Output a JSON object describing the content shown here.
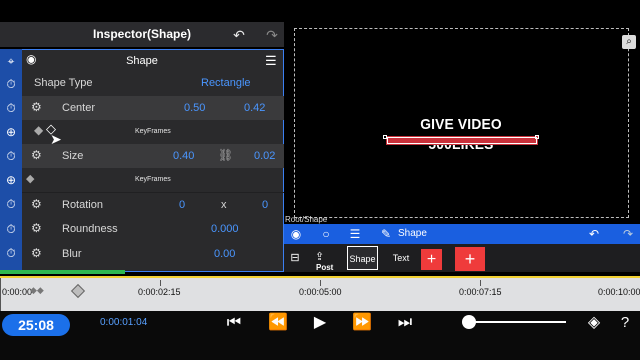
{
  "inspector": {
    "title": "Inspector(Shape)",
    "header_label": "Shape",
    "shape_type_label": "Shape Type",
    "shape_type_value": "Rectangle",
    "center": {
      "label": "Center",
      "x": "0.50",
      "y": "0.42"
    },
    "keyframes_label": "KeyFrames",
    "size": {
      "label": "Size",
      "x": "0.40",
      "y": "0.02"
    },
    "rotation": {
      "label": "Rotation",
      "value": "0",
      "sep": "x",
      "value2": "0"
    },
    "roundness": {
      "label": "Roundness",
      "value": "0.000"
    },
    "blur": {
      "label": "Blur",
      "value": "0.00"
    }
  },
  "canvas": {
    "text": "GIVE VIDEO 500LIKES"
  },
  "breadcrumb": "Root/Shape",
  "toolbar": {
    "shape_label": "Shape"
  },
  "layers": {
    "post_label": "Post",
    "shape_label": "Shape",
    "text_label": "Text",
    "add_symbol": "+"
  },
  "timeline": {
    "ticks": [
      "0:00:00",
      "0:00:02:15",
      "0:00:05:00",
      "0:00:07:15",
      "0:00:10:00"
    ]
  },
  "playback": {
    "duration": "25:08",
    "current_time": "0:00:01:04"
  }
}
